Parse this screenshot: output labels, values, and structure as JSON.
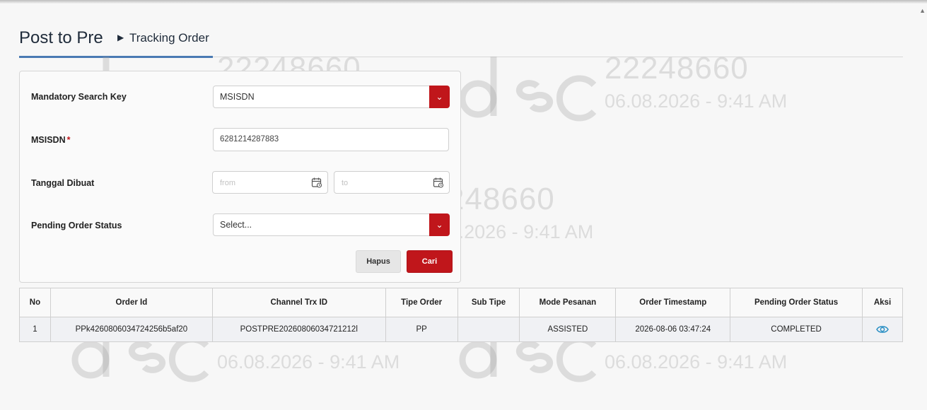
{
  "header": {
    "title": "Post to Pre",
    "breadcrumb": "Tracking Order",
    "accent_color": "#4a7ab3"
  },
  "watermark": {
    "logo_text": "dsc",
    "id": "22248660",
    "timestamp": "06.08.2026 - 9:41 AM"
  },
  "form": {
    "search_key_label": "Mandatory Search Key",
    "search_key_value": "MSISDN",
    "msisdn_label": "MSISDN",
    "required_mark": "*",
    "msisdn_value": "6281214287883",
    "tanggal_label": "Tanggal Dibuat",
    "from_placeholder": "from",
    "to_placeholder": "to",
    "status_label": "Pending Order Status",
    "status_value": "Select...",
    "hapus_label": "Hapus",
    "cari_label": "Cari",
    "brand_color": "#c0161b"
  },
  "table": {
    "columns": [
      "No",
      "Order Id",
      "Channel Trx ID",
      "Tipe Order",
      "Sub Tipe",
      "Mode Pesanan",
      "Order Timestamp",
      "Pending Order Status",
      "Aksi"
    ],
    "rows": [
      {
        "no": "1",
        "order_id": "PPk4260806034724256b5af20",
        "channel_trx_id": "POSTPRE20260806034721212l",
        "tipe_order": "PP",
        "sub_tipe": "",
        "mode_pesanan": "ASSISTED",
        "order_timestamp": "2026-08-06 03:47:24",
        "pending_order_status": "COMPLETED",
        "aksi_icon": "eye-icon"
      }
    ]
  }
}
